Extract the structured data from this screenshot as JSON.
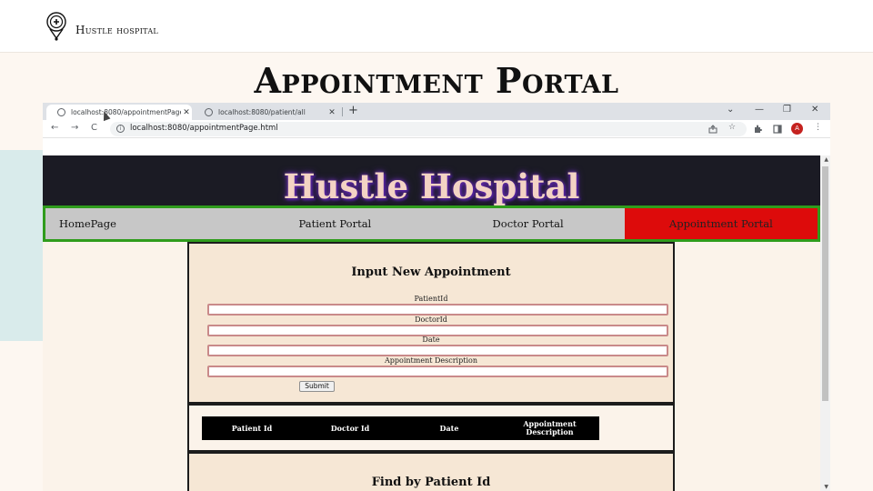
{
  "slide": {
    "brand": "Hustle hospital",
    "title": "Appointment Portal"
  },
  "browser": {
    "tabs": [
      {
        "title": "localhost:8080/appointmentPage.html",
        "close": "✕"
      },
      {
        "title": "localhost:8080/patient/all",
        "close": "✕"
      }
    ],
    "new_tab": "+",
    "window_controls": [
      "⌄",
      "—",
      "❐",
      "✕"
    ],
    "nav_buttons": [
      "←",
      "→",
      "C"
    ],
    "url": "localhost:8080/appointmentPage.html",
    "toolbar_icons": [
      "share-icon",
      "star-icon",
      "extensions-icon",
      "sidebar-icon"
    ],
    "avatar_initial": "A",
    "menu": "⋮"
  },
  "site": {
    "title": "Hustle Hospital",
    "nav": [
      {
        "label": "HomePage",
        "active": false
      },
      {
        "label": "Patient Portal",
        "active": false
      },
      {
        "label": "Doctor Portal",
        "active": false
      },
      {
        "label": "Appointment Portal",
        "active": true
      }
    ],
    "form": {
      "title": "Input New Appointment",
      "fields": [
        {
          "label": "PatientId",
          "value": ""
        },
        {
          "label": "DoctorId",
          "value": ""
        },
        {
          "label": "Date",
          "value": ""
        },
        {
          "label": "Appointment Description",
          "value": ""
        }
      ],
      "submit_label": "Submit"
    },
    "table": {
      "headers": [
        "Patient Id",
        "Doctor Id",
        "Date",
        "Appointment Description"
      ]
    },
    "find": {
      "title": "Find by Patient Id"
    }
  },
  "colors": {
    "nav_border": "#2f9c1c",
    "nav_active": "#dd0b0b",
    "header_bg": "#1b1b24",
    "panel_bg": "#f6e7d5"
  }
}
